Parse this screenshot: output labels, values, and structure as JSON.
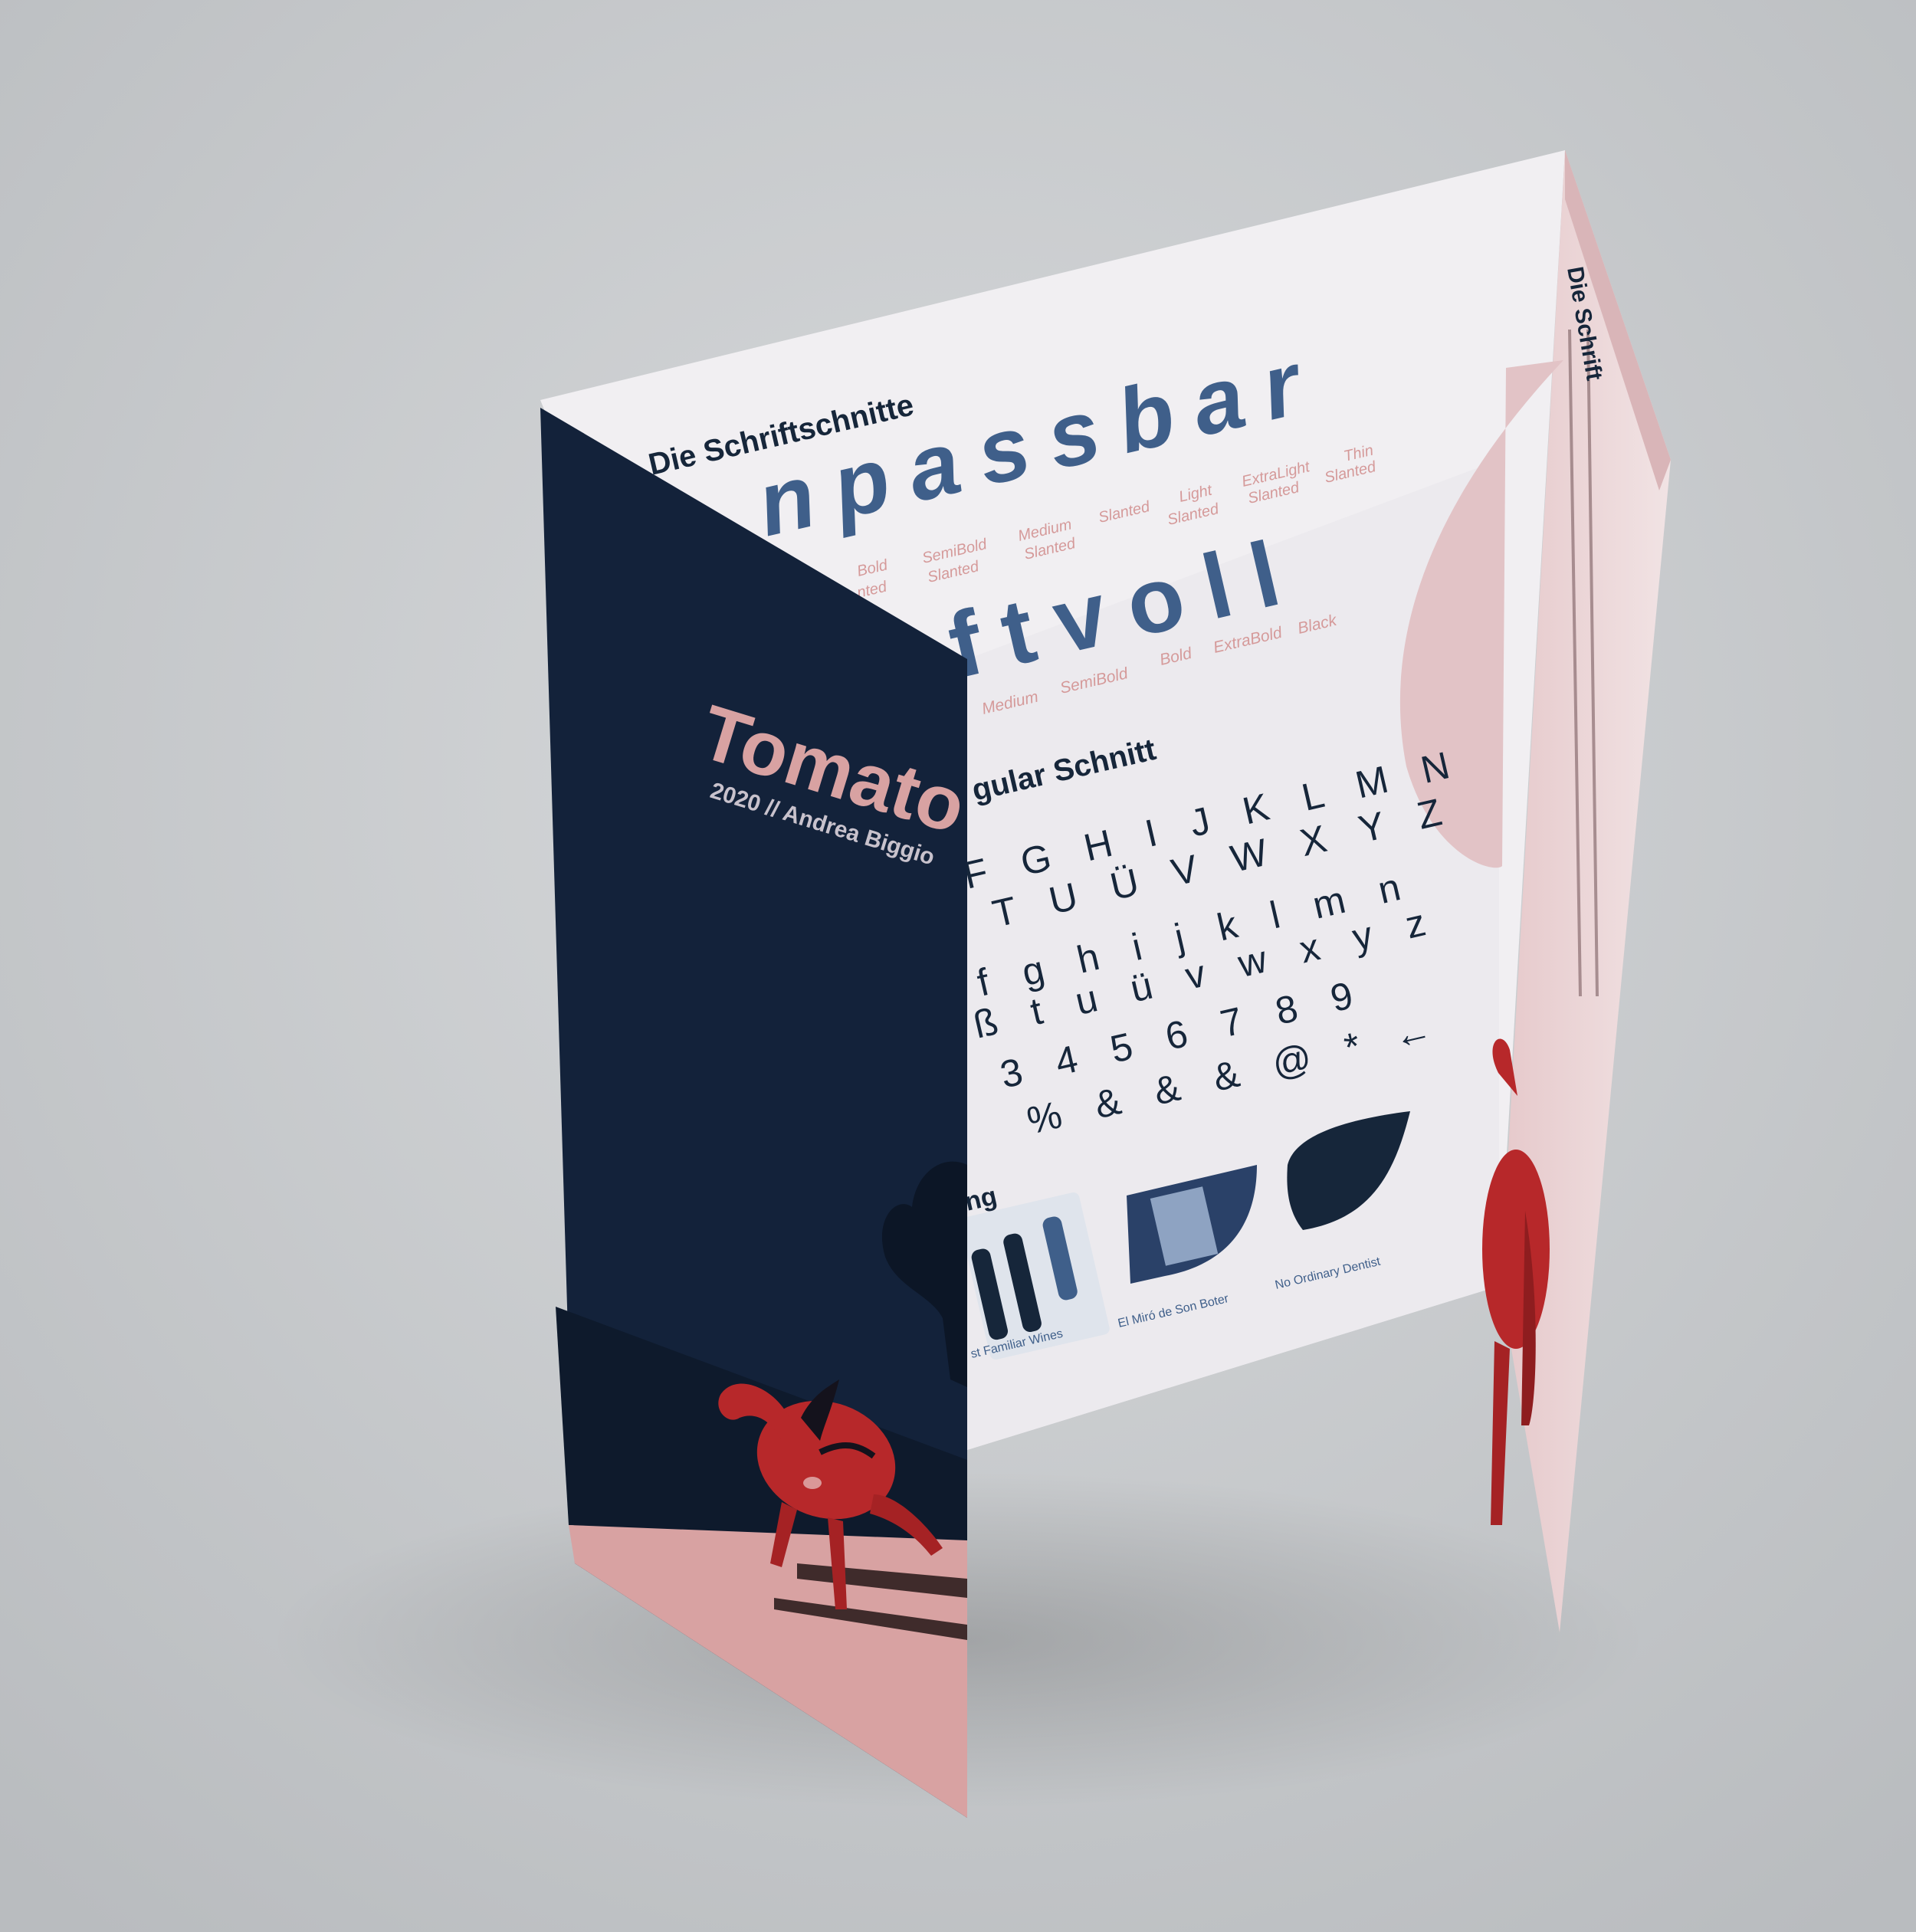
{
  "colors": {
    "background": "#c9ccce",
    "navy": "#16263a",
    "blue_type": "#3f5f8a",
    "pink": "#d8a2a2",
    "pink_text": "#d59a9a",
    "paper": "#f0eef1",
    "tomato_red": "#b7282a"
  },
  "cover": {
    "title": "Tomato",
    "subtitle": "2020 // Andrea Biggio"
  },
  "center": {
    "heading": "Die Schriftschnitte",
    "word_slanted": "npassbar",
    "slanted_labels": [
      "Bold",
      "SemiBold",
      "Medium",
      "Slanted",
      "Light",
      "ExtraLight",
      "Thin"
    ],
    "slanted_labels_second": [
      "nted",
      "Slanted",
      "Slanted",
      "Slanted",
      "Slanted",
      "Slanted"
    ],
    "word_upright": "ftvoll",
    "upright_labels": [
      "Medium",
      "SemiBold",
      "Bold",
      "ExtraBold",
      "Black"
    ],
    "regular_heading": "gular Schnitt",
    "glyph_rows": [
      "F G H I J K L M N",
      "T U Ü V W X Y Z",
      "f g h i j k l m n",
      "ß t u ü v w x y z",
      "3 4 5 6 7 8 9",
      "% & & & @ * ←"
    ],
    "usage_heading": "ng",
    "usage_captions": [
      "st Familiar Wines",
      "El Miró de Son Boter",
      "No Ordinary Dentist"
    ]
  },
  "right_panel": {
    "heading": "Die Schrift"
  }
}
